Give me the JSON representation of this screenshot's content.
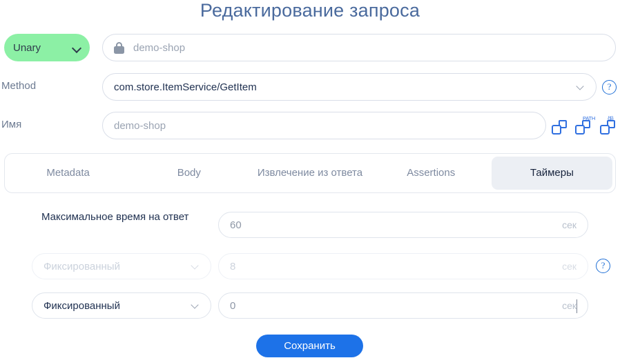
{
  "page_title": "Редактирование запроса",
  "request_type": {
    "label": "Unary",
    "icon": "chevron-down-icon",
    "color": "#8cf0a5"
  },
  "host": {
    "icon": "lock-icon",
    "placeholder": "demo-shop",
    "value": ""
  },
  "method": {
    "label": "Method",
    "value": "com.store.ItemService/GetItem",
    "icon": "chevron-down-icon",
    "help_icon": "question-circle-icon",
    "help_label": "?"
  },
  "name": {
    "label": "Имя",
    "placeholder": "demo-shop",
    "value": "",
    "actions": [
      {
        "icon": "copy-icon",
        "tag": ""
      },
      {
        "icon": "copy-path-icon",
        "tag": "PATH"
      },
      {
        "icon": "copy-variable-icon",
        "tag": "{$}"
      }
    ]
  },
  "tabs": [
    {
      "label": "Metadata",
      "active": false
    },
    {
      "label": "Body",
      "active": false
    },
    {
      "label": "Извлечение из ответа",
      "active": false
    },
    {
      "label": "Assertions",
      "active": false
    },
    {
      "label": "Таймеры",
      "active": true
    }
  ],
  "timers": {
    "max_response_time_label": "Максимальное время на ответ",
    "max_response_time_value": "60",
    "unit": "сек",
    "rows": [
      {
        "select_value": "Фиксированный",
        "input_value": "8",
        "unit": "сек",
        "disabled": true,
        "help_icon": "question-circle-icon",
        "help_label": "?"
      },
      {
        "select_value": "Фиксированный",
        "input_value": "0",
        "unit": "сек",
        "disabled": false
      }
    ]
  },
  "save_button": {
    "label": "Сохранить",
    "color": "#1d72e8"
  }
}
